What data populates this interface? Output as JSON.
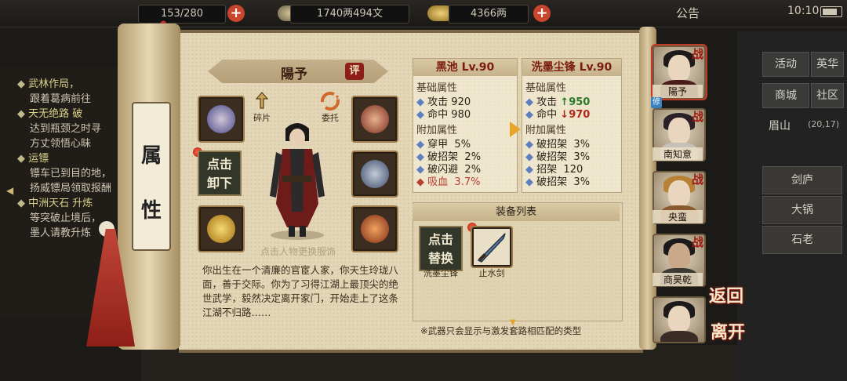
{
  "topbar": {
    "capacity": "153/280",
    "money": "1740两494文",
    "gold": "4366两",
    "notice": "公告",
    "time": "10:10"
  },
  "quest_panel": {
    "lines": [
      {
        "text": "武林作局，",
        "head": true
      },
      {
        "text": "跟着葛病前往",
        "head": false
      },
      {
        "text": "天无绝路 破",
        "head": true
      },
      {
        "text": "达到瓶颈之时寻",
        "head": false
      },
      {
        "text": "方丈领悟心昧",
        "head": false
      },
      {
        "text": "运镖",
        "head": true
      },
      {
        "text": "镖车已到目的地，",
        "head": false
      },
      {
        "text": "扬威镖局领取报酬",
        "head": false
      },
      {
        "text": "中洲天石 升炼",
        "head": true
      },
      {
        "text": "等突破止境后，",
        "head": false
      },
      {
        "text": "墨人请教升炼",
        "head": false
      }
    ]
  },
  "scroll": {
    "tab_label_top": "属",
    "tab_label_bottom": "性",
    "character_name": "陽予",
    "rate_label": "评",
    "action_fragment": "碎片",
    "action_entrust": "委托",
    "unload_line1": "点击",
    "unload_line2": "卸下",
    "change_outfit_hint": "点击人物更换服饰",
    "biography": "你出生在一个清廉的官宦人家，你天生玲珑八面，善于交际。你为了习得江湖上最顶尖的绝世武学，毅然决定离开家门，开始走上了这条江湖不归路……"
  },
  "current_weapon": {
    "title": "黑池 Lv.90",
    "base_title": "基础属性",
    "base": [
      {
        "name": "攻击",
        "value": "920"
      },
      {
        "name": "命中",
        "value": "980"
      }
    ],
    "extra_title": "附加属性",
    "extra": [
      {
        "name": "穿甲",
        "value": "5%",
        "red": false
      },
      {
        "name": "破招架",
        "value": "2%",
        "red": false
      },
      {
        "name": "破闪避",
        "value": "2%",
        "red": false
      },
      {
        "name": "吸血",
        "value": "3.7%",
        "red": true
      }
    ]
  },
  "compare_weapon": {
    "title": "洗墨尘锋 Lv.90",
    "base_title": "基础属性",
    "base": [
      {
        "name": "攻击",
        "value": "950",
        "dir": "↑"
      },
      {
        "name": "命中",
        "value": "970",
        "dir": "↓"
      }
    ],
    "extra_title": "附加属性",
    "extra": [
      {
        "name": "破招架",
        "value": "3%"
      },
      {
        "name": "破招架",
        "value": "3%"
      },
      {
        "name": "招架",
        "value": "120"
      },
      {
        "name": "破招架",
        "value": "3%"
      }
    ]
  },
  "equip_list": {
    "title": "装备列表",
    "swap_line1": "点击",
    "swap_line2": "替换",
    "items": [
      "洗墨尘锋",
      "止水剑"
    ],
    "note": "※武器只会显示与激发套路相匹配的类型"
  },
  "party": {
    "members": [
      {
        "name": "陽予",
        "tag": "战"
      },
      {
        "name": "南知意",
        "tag": "战"
      },
      {
        "name": "央蛮",
        "tag": "战"
      },
      {
        "name": "商昊乾",
        "tag": "战"
      },
      {
        "name": "",
        "tag": ""
      }
    ],
    "selected_badge": "修"
  },
  "right_menu": {
    "buttons": [
      "活动",
      "英华",
      "商城",
      "社区"
    ],
    "location": "眉山",
    "coords": "(20,17)",
    "side_items": [
      "剑庐",
      "大锅",
      "石老"
    ]
  },
  "nav": {
    "back": "返回",
    "leave": "离开"
  },
  "colors": {
    "paper": "#e2d6b6",
    "accent_red": "#8d1f18",
    "stat_up": "#2a7a2a",
    "stat_down": "#b2261b"
  }
}
